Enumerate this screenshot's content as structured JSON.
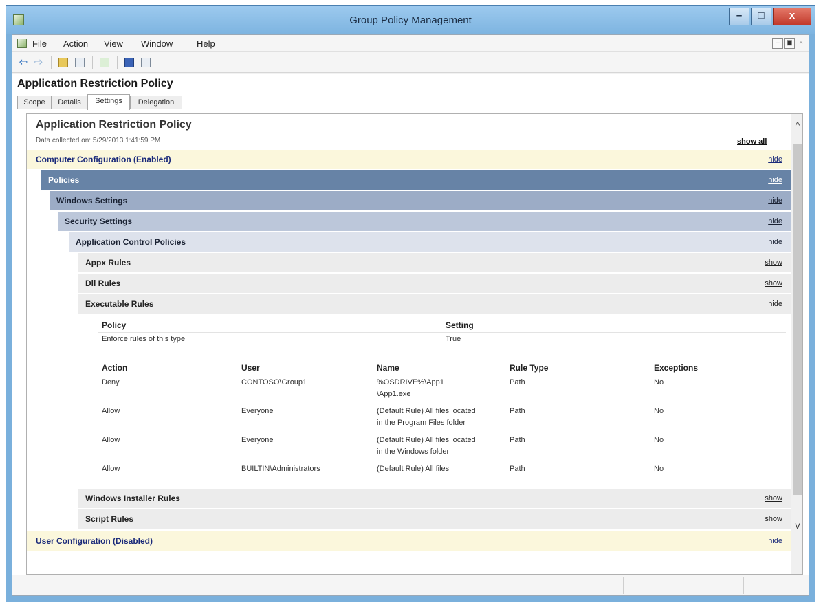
{
  "window": {
    "title": "Group Policy Management",
    "buttons": {
      "minimize": "–",
      "maximize": "□",
      "close": "x"
    }
  },
  "menu": {
    "items": [
      "File",
      "Action",
      "View",
      "Window",
      "Help"
    ],
    "mdi": {
      "minimize": "–",
      "restore": "▣",
      "close": "×"
    }
  },
  "toolbar": {
    "back": "⇦",
    "forward": "⇨",
    "icons": [
      "back-icon",
      "forward-icon",
      "up-folder-icon",
      "show-hide-tree-icon",
      "refresh-icon",
      "help-icon",
      "show-hide-action-pane-icon"
    ]
  },
  "page": {
    "heading": "Application Restriction Policy",
    "tabs": [
      "Scope",
      "Details",
      "Settings",
      "Delegation"
    ],
    "active_tab": "Settings"
  },
  "report": {
    "title": "Application Restriction Policy",
    "collected": "Data collected on: 5/29/2013 1:41:59 PM",
    "show_all": "show all",
    "sections": [
      {
        "label": "Computer Configuration (Enabled)",
        "action": "hide"
      },
      {
        "label": "Policies",
        "action": "hide"
      },
      {
        "label": "Windows Settings",
        "action": "hide"
      },
      {
        "label": "Security Settings",
        "action": "hide"
      },
      {
        "label": "Application Control Policies",
        "action": "hide"
      },
      {
        "label": "Appx Rules",
        "action": "show"
      },
      {
        "label": "Dll Rules",
        "action": "show"
      },
      {
        "label": "Executable Rules",
        "action": "hide"
      },
      {
        "label": "Windows Installer Rules",
        "action": "show"
      },
      {
        "label": "Script Rules",
        "action": "show"
      },
      {
        "label": "User Configuration (Disabled)",
        "action": "hide"
      }
    ],
    "policy_table": {
      "headers": [
        "Policy",
        "Setting"
      ],
      "rows": [
        [
          "Enforce rules of this type",
          "True"
        ]
      ]
    },
    "rules_table": {
      "headers": [
        "Action",
        "User",
        "Name",
        "Rule Type",
        "Exceptions"
      ],
      "rows": [
        {
          "action": "Deny",
          "user": "CONTOSO\\Group1",
          "name1": "%OSDRIVE%\\App1",
          "name2": "\\App1.exe",
          "rule_type": "Path",
          "exceptions": "No"
        },
        {
          "action": "Allow",
          "user": "Everyone",
          "name1": "(Default Rule) All files located",
          "name2": "in the Program Files folder",
          "rule_type": "Path",
          "exceptions": "No"
        },
        {
          "action": "Allow",
          "user": "Everyone",
          "name1": "(Default Rule) All files located",
          "name2": "in the Windows folder",
          "rule_type": "Path",
          "exceptions": "No"
        },
        {
          "action": "Allow",
          "user": "BUILTIN\\Administrators",
          "name1": "(Default Rule) All files",
          "name2": "",
          "rule_type": "Path",
          "exceptions": "No"
        }
      ]
    }
  },
  "colors": {
    "config_bar": "#fbf7dc",
    "policies_bar": "#6783a6",
    "windows_settings_bar": "#9cacc6",
    "security_settings_bar": "#bcc7da",
    "app_control_bar": "#dde2ec",
    "rules_bar": "#ececec",
    "link": "#1a2a7a"
  }
}
